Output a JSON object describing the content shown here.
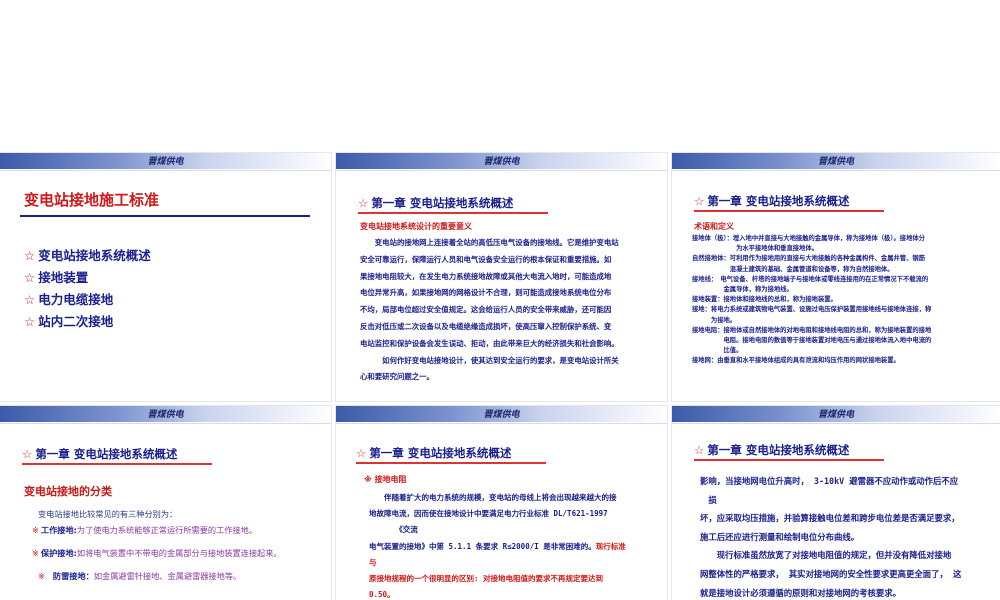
{
  "header_text": "晋煤供电",
  "chapter_title": "第一章 变电站接地系统概述",
  "star_glyph": "☆",
  "slide1": {
    "title": "变电站接地施工标准",
    "items": [
      "变电站接地系统概述",
      "接地装置",
      "电力电缆接地",
      "站内二次接地"
    ]
  },
  "slide2": {
    "subtitle": "变电站接地系统设计的重要意义",
    "lines": [
      "　　变电站的接地网上连接着全站的高低压电气设备的接地线。它是维护变电站",
      "安全可靠运行，保障运行人员和电气设备安全运行的根本保证和重要措施。如",
      "果接地电阻较大，在发生电力系统接地故障或其他大电流入地时，可能造成地",
      "电位异常升高，如果接地网的网格设计不合理，则可能造成接地系统电位分布",
      "不均，局部电位超过安全值规定。这会给运行人员的安全带来威胁，还可能因",
      "反击对低压或二次设备以及电缆绝缘造成损坏，使高压窜入控制保护系统、变",
      "电站监控和保护设备会发生误动、拒动，由此带来巨大的经济损失和社会影响。",
      "　　　如何作好变电站接地设计，使其达到安全运行的要求，是变电站设计所关",
      "心和要研究问题之一。"
    ]
  },
  "slide3": {
    "subtitle": "术语和定义",
    "terms": [
      "接地体（极）：埋入地中并直接与大地接触的金属导体，称为接地体（极）。接地体分",
      "　　　　　　　为水平接地体和垂直接地体。",
      "自然接地体：可利用作为接地用的直接与大地接触的各种金属构件、金属井管、钢筋",
      "　　　　　　混凝土建筑的基础、金属管道和设备等，称为自然接地体。",
      "接地线：　电气设备、杆塔的接地端子与接地体或零线连接用的在正常情况下不载流的",
      "　　　　　金属导体，称为接地线。",
      "接地装置：接地体和接地线的总和，称为接地装置。",
      "接地：将电力系统或建筑物电气装置、设施过电压保护装置用接地线与接地体连接，称",
      "　　　为接地。",
      "接地电阻：接地体或自然接地体的对地电阻和接地线电阻的总和，称为接地装置的接地",
      "　　　　　电阻。接地电阻的数值等于接地装置对地电压与通过接地体流入地中电流的",
      "　　　　　比值。",
      "接地网：由垂直和水平接地体组成的具有泄流和均压作用的网状接地装置。"
    ]
  },
  "slide4": {
    "subtitle": "变电站接地的分类",
    "intro": "变电站接地比较常见的有三种分别为：",
    "marker": "※",
    "items": [
      {
        "label": "工作接地:",
        "text": "为了使电力系统能够正常运行所需要的工作接地。"
      },
      {
        "label": "保护接地:",
        "text": "如将电气装置中不带电的金属部分与接地装置连接起来。"
      },
      {
        "label": "防雷接地：",
        "text": "如金属避雷针接地、金属避雷器接地等。"
      }
    ]
  },
  "slide5": {
    "subtitle": "※ 接地电阻",
    "lines": [
      "　　伴随着扩大的电力系统的规模，变电站的母线上将会出现越来越大的接",
      "地故障电流，因而使在接地设计中要满足电力行业标准 DL/T621-1997",
      "　　　　《交流",
      "电气装置的接地》中第 5.1.1 条要求 R≤2000/I 是非常困难的。"
    ],
    "red_tail": "现行标准",
    "red_and": "与",
    "red_line": "原接地规程的一个很明显的区别: 对接地电阻值的要求不再规定要达到",
    "red_value": "0.50。"
  },
  "slide6": {
    "lines": [
      "影响，当接地网电位升高时， 3-10kV 避雷器不应动作或动作后不应",
      "　损",
      "坏，应采取均压措施，并验算接触电位差和跨步电位差是否满足要求，",
      "施工后还应进行测量和绘制电位分布曲线。",
      "　　现行标准虽然放宽了对接地电阻值的规定，但并没有降低对接地",
      "网整体性的严格要求， 其实对接地网的安全性要求更高更全面了， 这",
      "就是接地设计必须遵循的原则和对接地网的考核要求。"
    ]
  }
}
